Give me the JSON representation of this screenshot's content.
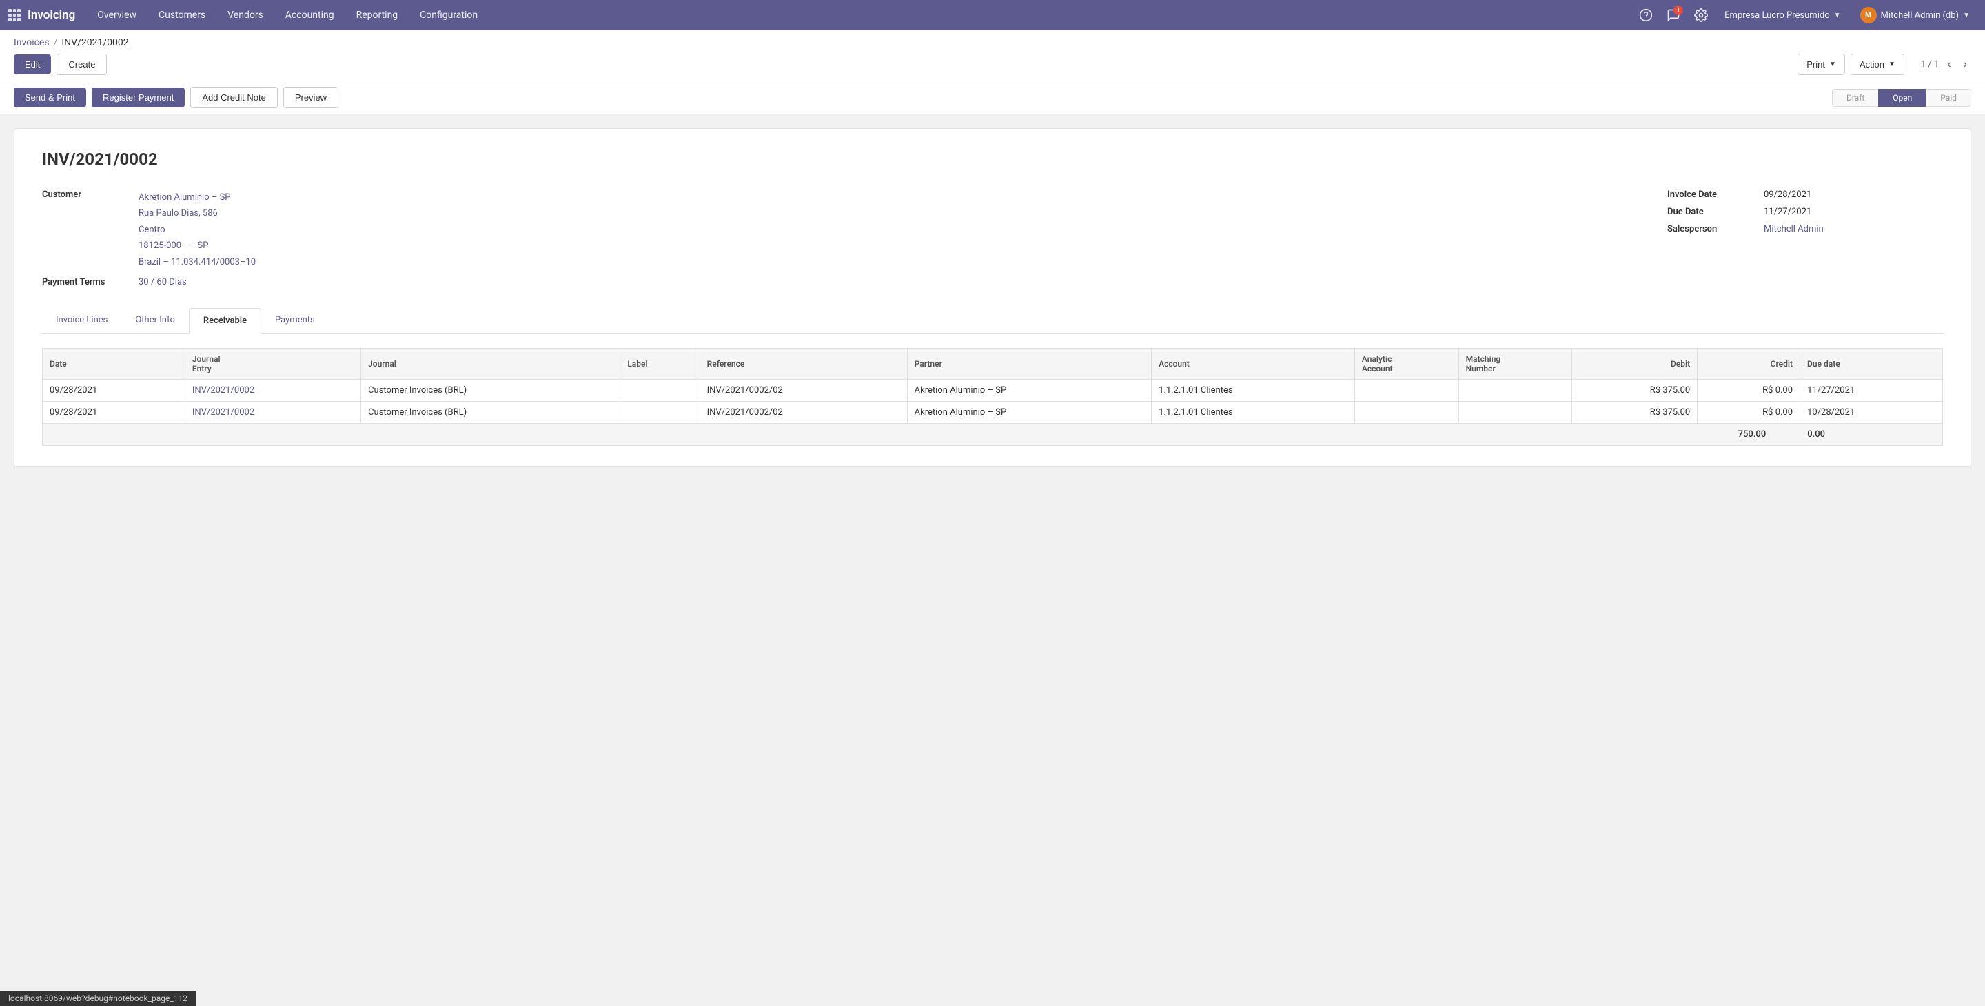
{
  "app": {
    "title": "Invoicing"
  },
  "nav": {
    "items": [
      {
        "id": "overview",
        "label": "Overview"
      },
      {
        "id": "customers",
        "label": "Customers"
      },
      {
        "id": "vendors",
        "label": "Vendors"
      },
      {
        "id": "accounting",
        "label": "Accounting"
      },
      {
        "id": "reporting",
        "label": "Reporting"
      },
      {
        "id": "configuration",
        "label": "Configuration"
      }
    ],
    "notification_count": "1",
    "company": "Empresa Lucro Presumido",
    "user": "Mitchell Admin (db)"
  },
  "breadcrumb": {
    "parent_label": "Invoices",
    "current_label": "INV/2021/0002"
  },
  "toolbar": {
    "edit_label": "Edit",
    "create_label": "Create",
    "print_label": "Print",
    "action_label": "Action",
    "pagination": "1 / 1"
  },
  "workflow": {
    "send_print_label": "Send & Print",
    "register_payment_label": "Register Payment",
    "add_credit_note_label": "Add Credit Note",
    "preview_label": "Preview",
    "statuses": [
      {
        "id": "draft",
        "label": "Draft"
      },
      {
        "id": "open",
        "label": "Open",
        "active": true
      },
      {
        "id": "paid",
        "label": "Paid"
      }
    ]
  },
  "invoice": {
    "number": "INV/2021/0002",
    "customer_label": "Customer",
    "customer_name": "Akretion Aluminio – SP",
    "customer_address1": "Rua Paulo Dias, 586",
    "customer_address2": "Centro",
    "customer_address3": "18125-000 – –SP",
    "customer_country": "Brazil – 11.034.414/0003–10",
    "payment_terms_label": "Payment Terms",
    "payment_terms": "30 / 60 Dias",
    "invoice_date_label": "Invoice Date",
    "invoice_date": "09/28/2021",
    "due_date_label": "Due Date",
    "due_date": "11/27/2021",
    "salesperson_label": "Salesperson",
    "salesperson": "Mitchell Admin"
  },
  "tabs": [
    {
      "id": "invoice-lines",
      "label": "Invoice Lines"
    },
    {
      "id": "other-info",
      "label": "Other Info"
    },
    {
      "id": "receivable",
      "label": "Receivable",
      "active": true
    },
    {
      "id": "payments",
      "label": "Payments"
    }
  ],
  "table": {
    "columns": [
      {
        "id": "date",
        "label": "Date"
      },
      {
        "id": "journal-entry",
        "label": "Journal Entry"
      },
      {
        "id": "journal",
        "label": "Journal"
      },
      {
        "id": "label",
        "label": "Label"
      },
      {
        "id": "reference",
        "label": "Reference"
      },
      {
        "id": "partner",
        "label": "Partner"
      },
      {
        "id": "account",
        "label": "Account"
      },
      {
        "id": "analytic-account",
        "label": "Analytic Account"
      },
      {
        "id": "matching-number",
        "label": "Matching Number"
      },
      {
        "id": "debit",
        "label": "Debit"
      },
      {
        "id": "credit",
        "label": "Credit"
      },
      {
        "id": "due-date",
        "label": "Due date"
      }
    ],
    "rows": [
      {
        "date": "09/28/2021",
        "journal_entry": "INV/2021/0002",
        "journal": "Customer Invoices (BRL)",
        "label": "",
        "reference": "INV/2021/0002/02",
        "partner": "Akretion Aluminio – SP",
        "account": "1.1.2.1.01 Clientes",
        "analytic_account": "",
        "matching_number": "",
        "debit": "R$ 375.00",
        "credit": "R$ 0.00",
        "due_date": "11/27/2021"
      },
      {
        "date": "09/28/2021",
        "journal_entry": "INV/2021/0002",
        "journal": "Customer Invoices (BRL)",
        "label": "",
        "reference": "INV/2021/0002/02",
        "partner": "Akretion Aluminio – SP",
        "account": "1.1.2.1.01 Clientes",
        "analytic_account": "",
        "matching_number": "",
        "debit": "R$ 375.00",
        "credit": "R$ 0.00",
        "due_date": "10/28/2021"
      }
    ],
    "footer": {
      "debit_total": "750.00",
      "credit_total": "0.00"
    }
  },
  "statusbar": {
    "url": "localhost:8069/web?debug#notebook_page_112"
  }
}
